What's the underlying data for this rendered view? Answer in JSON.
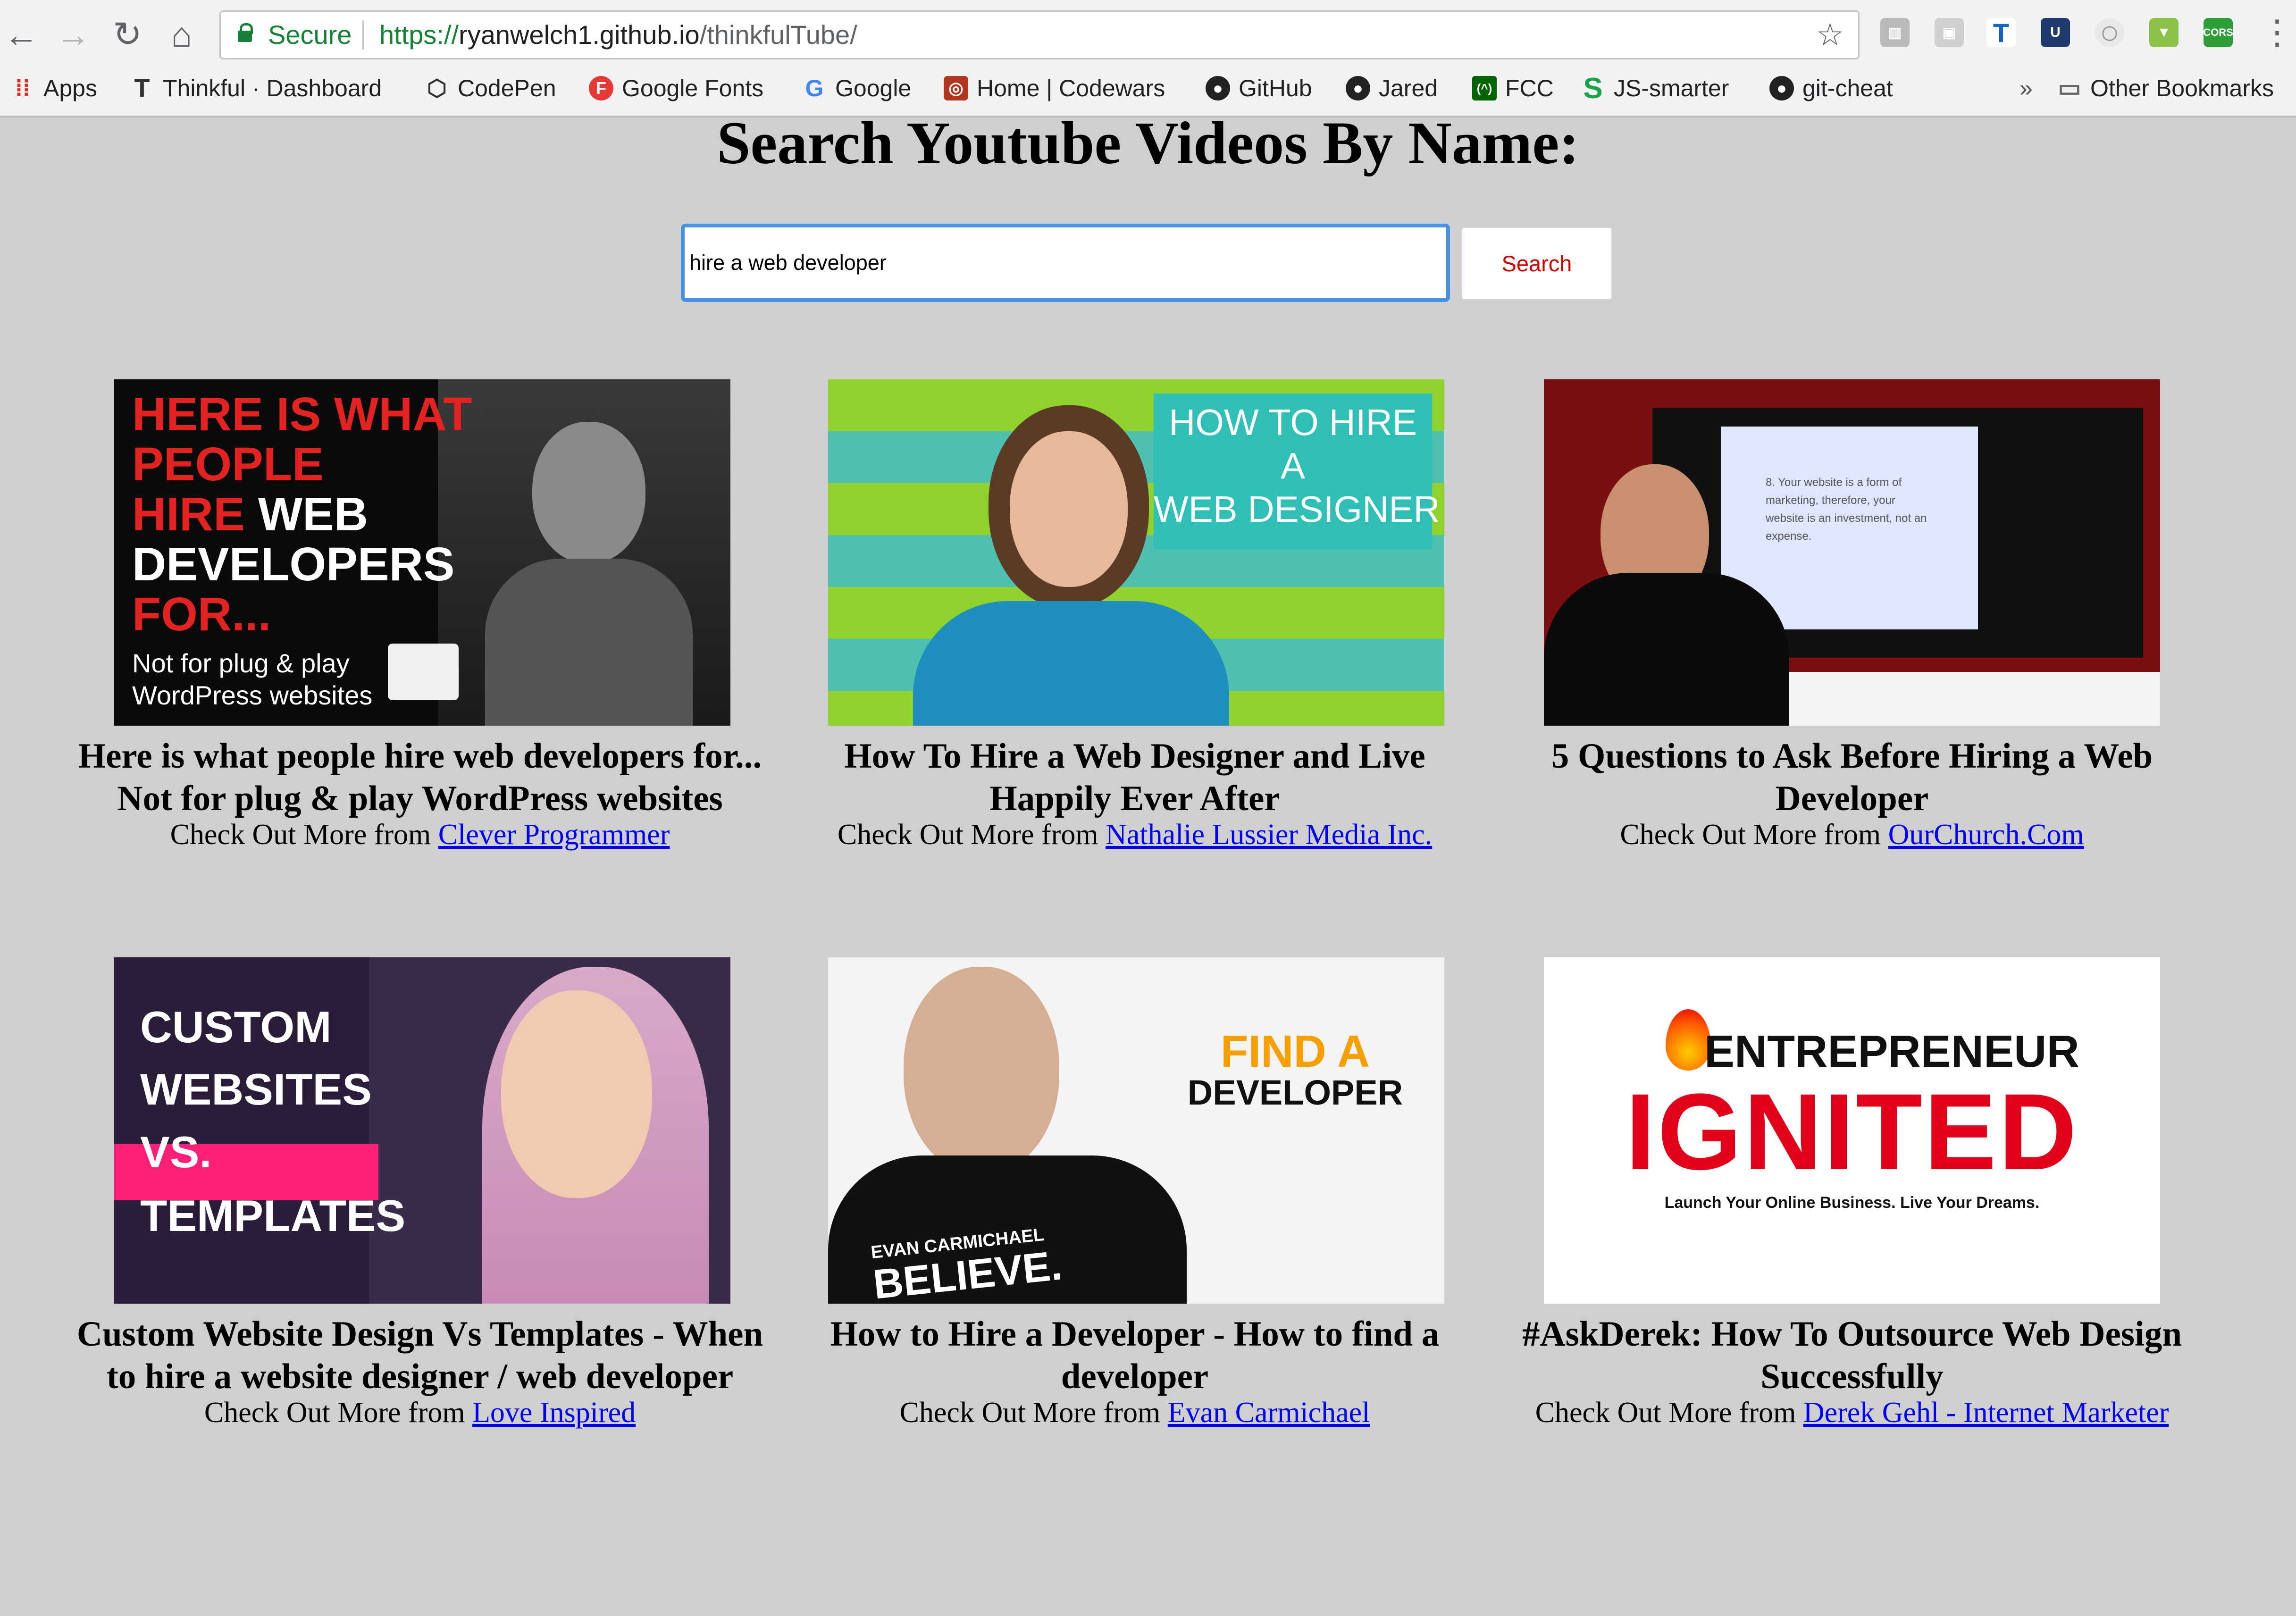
{
  "browser": {
    "secure_label": "Secure",
    "url_scheme": "https://",
    "url_host": "ryanwelch1.github.io",
    "url_path": "/thinkfulTube/",
    "bookmarks": [
      {
        "label": "Apps",
        "icon": "apps-grid-icon"
      },
      {
        "label": "Thinkful · Dashboard",
        "icon": "thinkful-icon"
      },
      {
        "label": "CodePen",
        "icon": "codepen-icon"
      },
      {
        "label": "Google Fonts",
        "icon": "google-fonts-icon"
      },
      {
        "label": "Google",
        "icon": "google-icon"
      },
      {
        "label": "Home | Codewars",
        "icon": "codewars-icon"
      },
      {
        "label": "GitHub",
        "icon": "github-icon"
      },
      {
        "label": "Jared",
        "icon": "github-icon"
      },
      {
        "label": "FCC",
        "icon": "fcc-icon"
      },
      {
        "label": "JS-smarter",
        "icon": "s-icon"
      },
      {
        "label": "git-cheat",
        "icon": "github-icon"
      }
    ],
    "overflow_chevron": "»",
    "other_bookmarks": "Other Bookmarks"
  },
  "page": {
    "title": "Search Youtube Videos By Name:",
    "search_value": "hire a web developer",
    "search_button": "Search",
    "channel_prefix": "Check Out More from"
  },
  "results": [
    {
      "title": "Here is what people hire web developers for... Not for plug & play WordPress websites",
      "channel": "Clever Programmer",
      "thumb_text": {
        "line1": "HERE IS WHAT",
        "line2": "PEOPLE",
        "line3a": "HIRE",
        "line3b": "WEB",
        "line4": "DEVELOPERS",
        "line5": "FOR...",
        "sub1": "Not for plug & play",
        "sub2": "WordPress websites"
      }
    },
    {
      "title": "How To Hire a Web Designer and Live Happily Ever After",
      "channel": "Nathalie Lussier Media Inc.",
      "thumb_text": {
        "line1": "HOW TO HIRE",
        "line2": "A",
        "line3": "WEB DESIGNER"
      }
    },
    {
      "title": "5 Questions to Ask Before Hiring a Web Developer",
      "channel": "OurChurch.Com",
      "thumb_text": {
        "screen": "8. Your website is a form of marketing, therefore, your website is an investment, not an expense."
      }
    },
    {
      "title": "Custom Website Design Vs Templates - When to hire a website designer / web developer",
      "channel": "Love Inspired",
      "thumb_text": {
        "line1": "CUSTOM",
        "line2": "WEBSITES",
        "line3": "VS.",
        "line4": "TEMPLATES"
      }
    },
    {
      "title": "How to Hire a Developer - How to find a developer",
      "channel": "Evan Carmichael",
      "thumb_text": {
        "line1": "FIND A",
        "line2": "DEVELOPER",
        "shirt1": "EVAN CARMICHAEL",
        "shirt2": "BELIEVE."
      }
    },
    {
      "title": "#AskDerek: How To Outsource Web Design Successfully",
      "channel": "Derek Gehl - Internet Marketer",
      "thumb_text": {
        "line1": "ENTREPRENEUR",
        "line2": "IGNITED",
        "tagline": "Launch Your Online Business. Live Your Dreams."
      }
    }
  ]
}
